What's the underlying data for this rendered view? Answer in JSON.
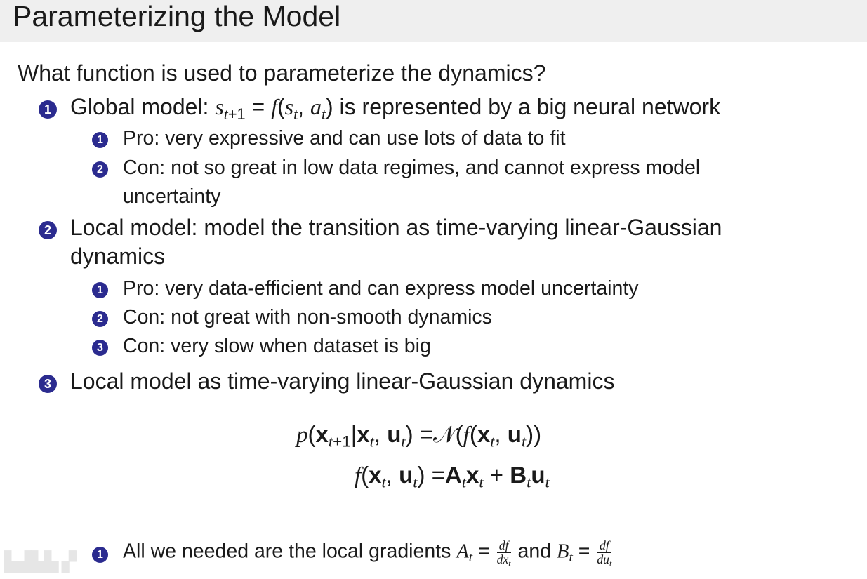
{
  "slide": {
    "title": "Parameterizing the Model",
    "question": "What function is used to parameterize the dynamics?",
    "items": [
      {
        "num": "1",
        "text": "Global model: $s_{t+1} = f(s_t, a_t)$ is represented by a big neural network",
        "sub": [
          {
            "num": "1",
            "text": "Pro: very expressive and can use lots of data to fit"
          },
          {
            "num": "2",
            "text": "Con: not so great in low data regimes, and cannot express model",
            "cont": "uncertainty"
          }
        ]
      },
      {
        "num": "2",
        "text": "Local model: model the transition as time-varying linear-Gaussian",
        "cont": "dynamics",
        "sub": [
          {
            "num": "1",
            "text": "Pro: very data-efficient and can express model uncertainty"
          },
          {
            "num": "2",
            "text": "Con: not great with non-smooth dynamics"
          },
          {
            "num": "3",
            "text": "Con: very slow when dataset is big"
          }
        ]
      },
      {
        "num": "3",
        "text": "Local model as time-varying linear-Gaussian dynamics",
        "equations": [
          "$p(\\b{x}_{t+1}|\\b{x}_t, \\b{u}_t) =𝒩(f(\\b{x}_t, \\b{u}_t))$",
          "$f(\\b{x}_t, \\b{u}_t) =\\b{A}_t\\b{x}_t + \\b{B}_t\\b{u}_t$"
        ],
        "sub": [
          {
            "num": "1",
            "text": "All we needed are the local gradients $A_t = \\frac{df}{dx_t}$ and $B_t = \\frac{df}{du_t}$"
          }
        ]
      }
    ],
    "watermark": "LdiL.ai"
  },
  "colors": {
    "header_bg": "#efefef",
    "bullet": "#2b2b8f",
    "text": "#1a1a1a"
  }
}
